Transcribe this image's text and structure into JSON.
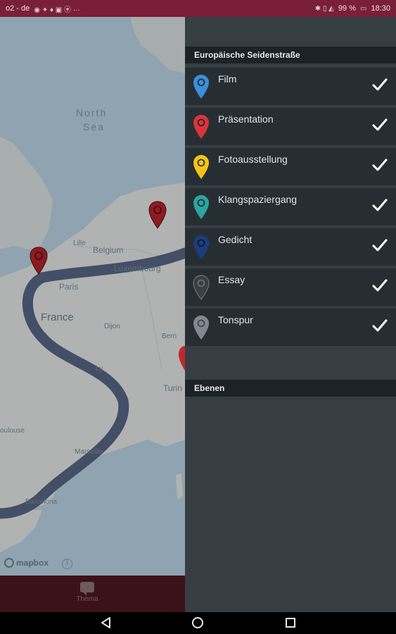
{
  "status_bar": {
    "carrier": "o2 - de",
    "battery": "99 %",
    "time": "18:30"
  },
  "map": {
    "labels": {
      "north_sea_1": "North",
      "north_sea_2": "Sea",
      "belgium": "Belgium",
      "luxembourg": "Luxembourg",
      "paris": "Paris",
      "france": "France",
      "dijon": "Dijon",
      "bern": "Bern",
      "lyon": "Ly",
      "turin": "Turin",
      "toulouse": "oulouse",
      "marseille": "Marseille",
      "barcelona": "Barcelona",
      "lille": "Lille"
    },
    "attribution": "mapbox",
    "info_symbol": "i",
    "route_color": "#3b4560"
  },
  "bottom_tab": {
    "thema_label": "Thema"
  },
  "panel": {
    "section_title": "Europäische Seidenstraße",
    "layers": [
      {
        "label": "Film",
        "color": "#3a8fd6",
        "icon": "map-pin-icon"
      },
      {
        "label": "Präsentation",
        "color": "#d9343b",
        "icon": "map-pin-icon"
      },
      {
        "label": "Fotoausstellung",
        "color": "#f2c417",
        "icon": "map-pin-icon"
      },
      {
        "label": "Klangspaziergang",
        "color": "#2aa5a0",
        "icon": "map-pin-icon"
      },
      {
        "label": "Gedicht",
        "color": "#1c3d7a",
        "icon": "map-pin-icon"
      },
      {
        "label": "Essay",
        "color": "#3a3f44",
        "icon": "map-pin-icon"
      },
      {
        "label": "Tonspur",
        "color": "#808890",
        "icon": "map-pin-icon"
      }
    ],
    "layers_header": "Ebenen"
  },
  "colors": {
    "status_bar": "#7a1f3b",
    "panel_bg": "#363e44",
    "item_bg": "#272e33",
    "header_bg": "#1c2226",
    "map_pin": "#8e1b20"
  }
}
